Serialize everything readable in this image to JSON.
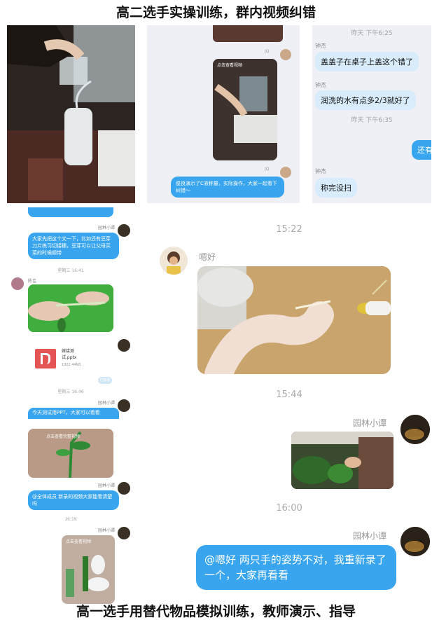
{
  "captions": {
    "top": "高二选手实操训练，群内视频纠错",
    "bottom": "高一选手用替代物品模拟训练，教师演示、指导"
  },
  "panel_b": {
    "badge": "JQ",
    "badge2": "JQ",
    "video_label": "点击查看视频",
    "bubble": "俊良演示了C液称量，实际操作，大家一起看下纠错～"
  },
  "panel_c": {
    "ts1": "昨天 下午6:25",
    "sender1": "钟杰",
    "msg1": "盖盖子在桌子上盖这个错了",
    "sender2": "钟杰",
    "msg2": "润洗的水有点多2/3就好了",
    "ts2": "昨天 下午6:35",
    "msg3": "还有",
    "sender3": "钟杰",
    "msg4": "称完没扫"
  },
  "panel_d": {
    "sender": "园林小谭",
    "msg1": "大家先把这个文一下，比如还有豆芽刀片练习切接穗，豆芽可以让父母买菜的时候顺带",
    "ts1": "星期三 16:41",
    "sender2": "陈佳",
    "sender3": "园林小谭",
    "file_name": "嫁接测试.pptx",
    "file_size": "1022.44KB",
    "file_status": "已接收",
    "ts2": "星期三 16:46",
    "sender4": "园林小谭",
    "msg2": "今天测试用PPT，大家可以看看",
    "video_label": "点击查看完整视频",
    "sender5": "园林小谭",
    "msg3": "@全体成员 新录的视频大家能看清楚吗",
    "ts3": "16:16",
    "sender6": "园林小谭",
    "video_label2": "点击查看视频"
  },
  "panel_e": {
    "ts1": "15:22",
    "sender1": "嗯好",
    "ts2": "15:44",
    "sender2": "园林小谭",
    "ts3": "16:00",
    "sender3": "园林小谭",
    "msg": "@嗯好 两只手的姿势不对，我重新录了一个，大家再看看"
  }
}
